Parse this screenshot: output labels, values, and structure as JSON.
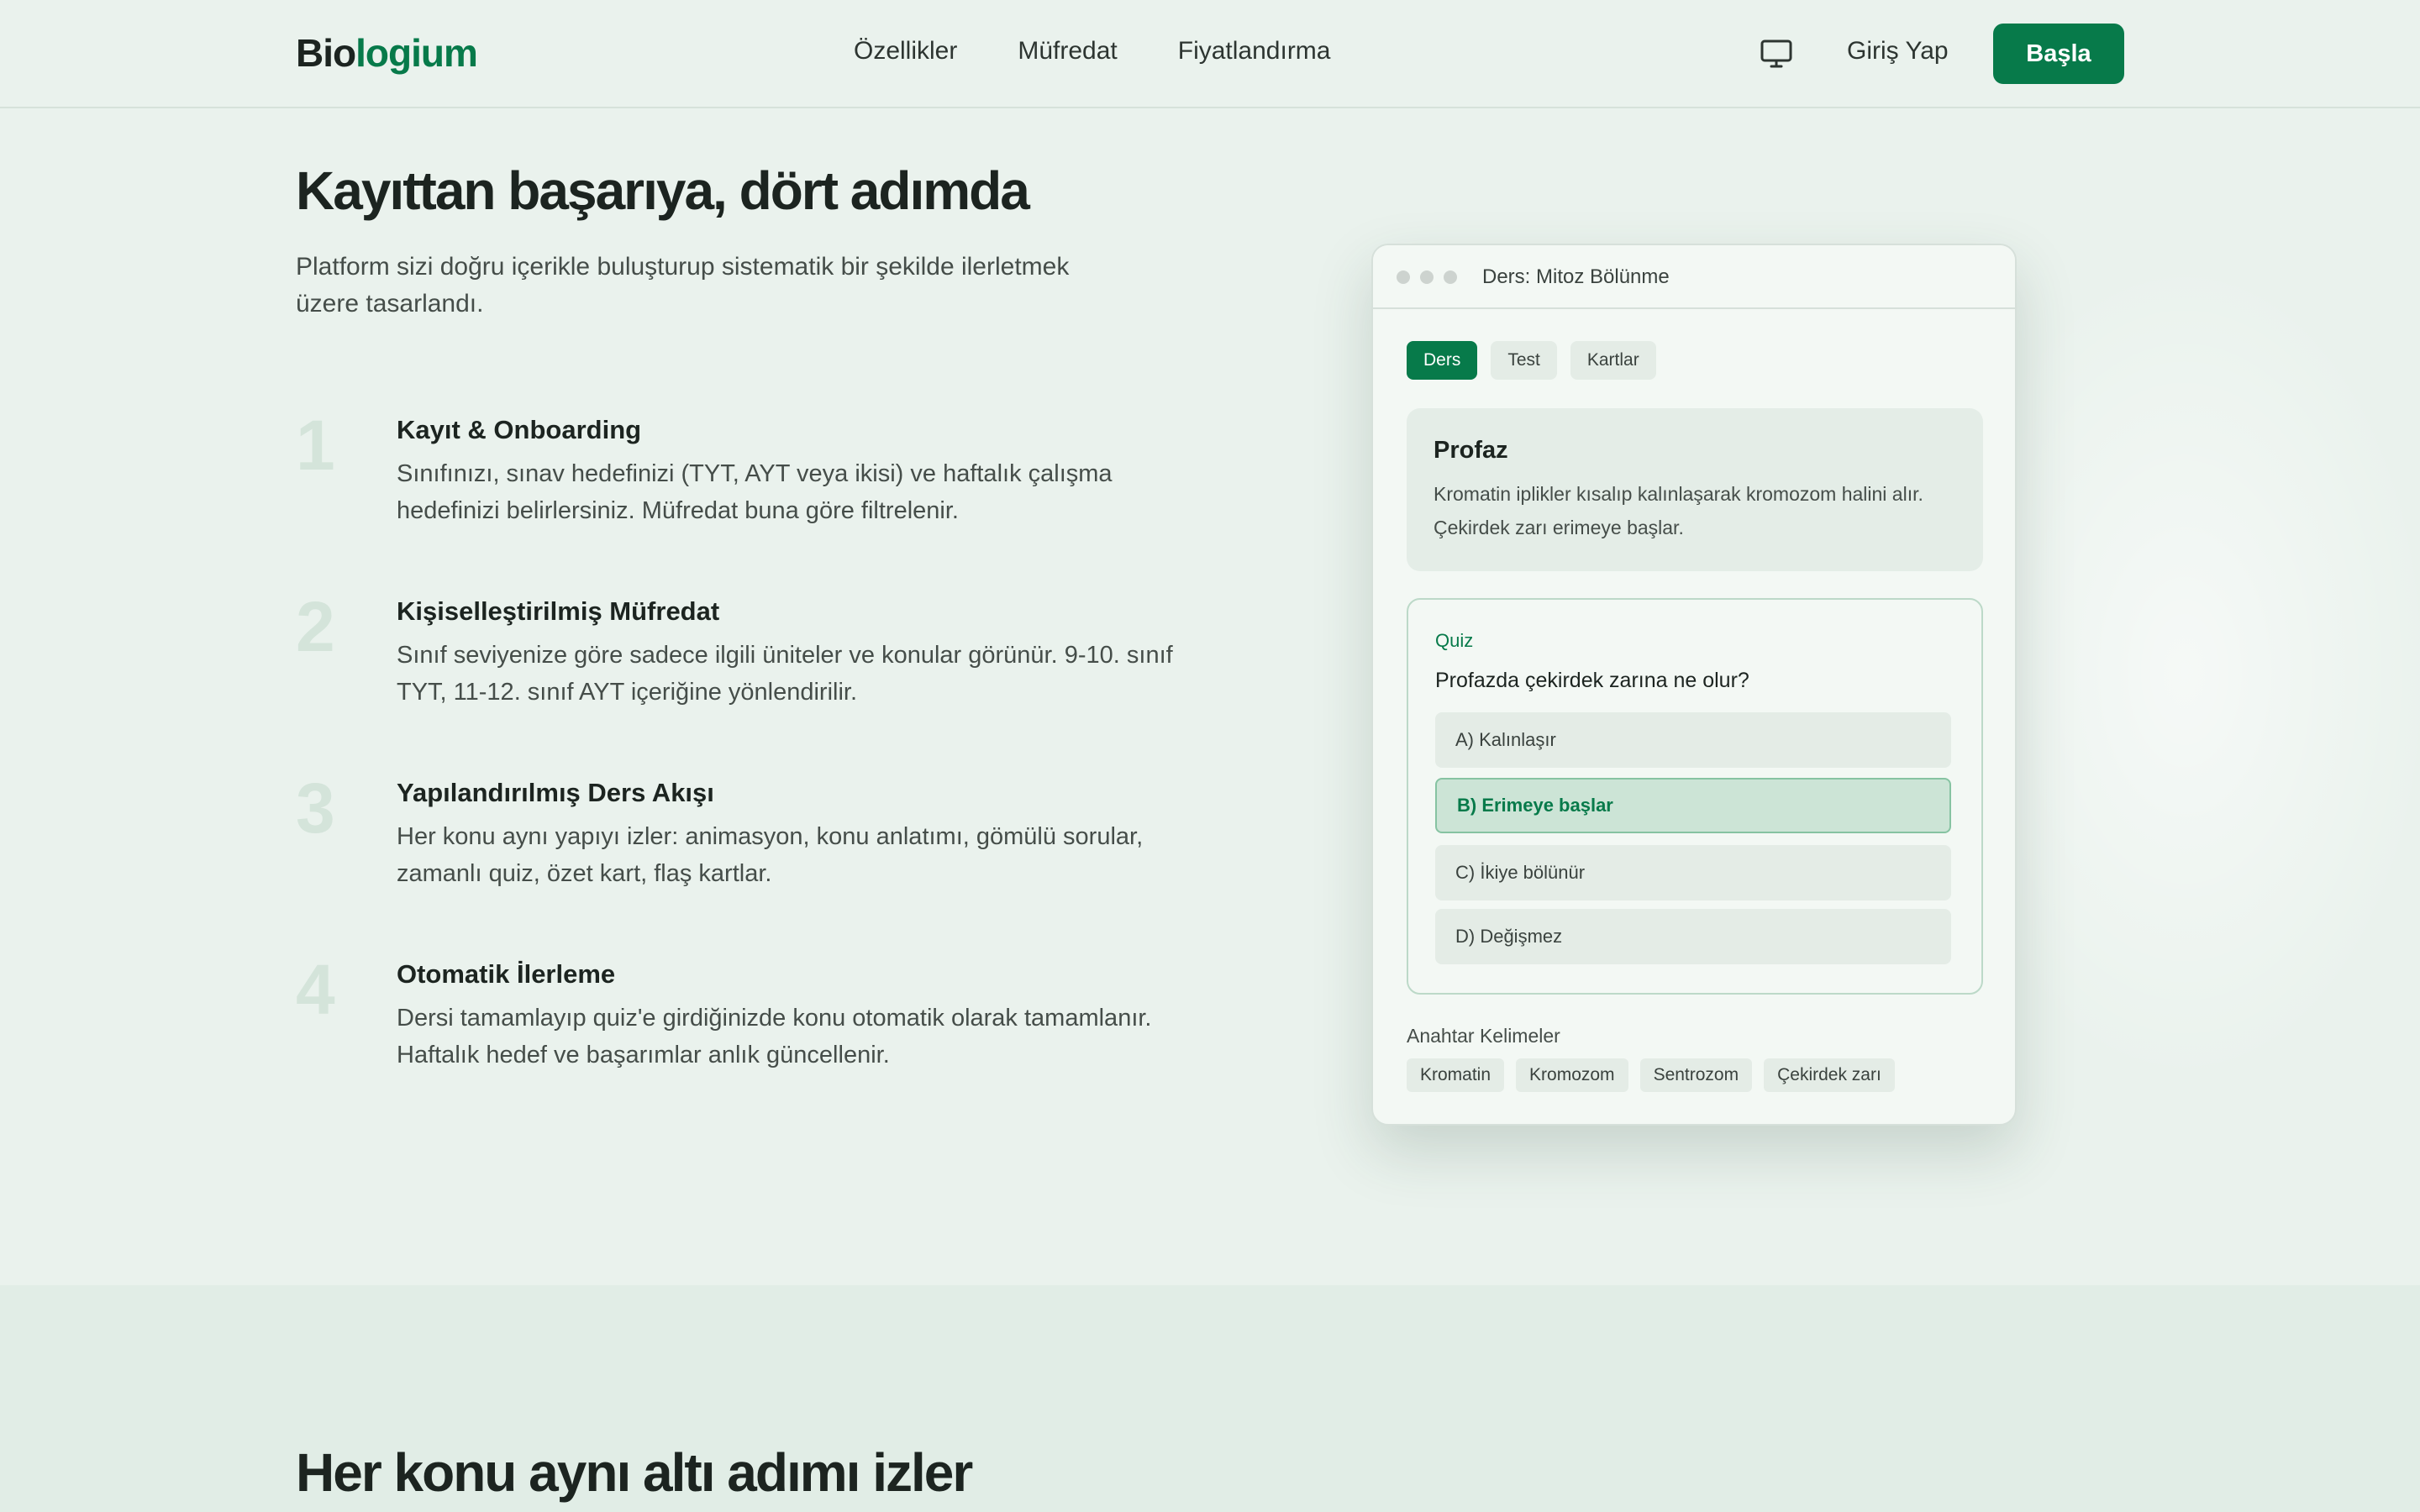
{
  "nav": {
    "logo_part1": "Bio",
    "logo_part2": "logium",
    "links": [
      "Özellikler",
      "Müfredat",
      "Fiyatlandırma"
    ],
    "login": "Giriş Yap",
    "cta": "Başla"
  },
  "hero": {
    "title": "Kayıttan başarıya, dört adımda",
    "subtitle": "Platform sizi doğru içerikle buluşturup sistematik bir şekilde ilerletmek üzere tasarlandı.",
    "steps": [
      {
        "num": "1",
        "title": "Kayıt & Onboarding",
        "desc": "Sınıfınızı, sınav hedefinizi (TYT, AYT veya ikisi) ve haftalık çalışma hedefinizi belirlersiniz. Müfredat buna göre filtrelenir."
      },
      {
        "num": "2",
        "title": "Kişiselleştirilmiş Müfredat",
        "desc": "Sınıf seviyenize göre sadece ilgili üniteler ve konular görünür. 9-10. sınıf TYT, 11-12. sınıf AYT içeriğine yönlendirilir."
      },
      {
        "num": "3",
        "title": "Yapılandırılmış Ders Akışı",
        "desc": "Her konu aynı yapıyı izler: animasyon, konu anlatımı, gömülü sorular, zamanlı quiz, özet kart, flaş kartlar."
      },
      {
        "num": "4",
        "title": "Otomatik İlerleme",
        "desc": "Dersi tamamlayıp quiz'e girdiğinizde konu otomatik olarak tamamlanır. Haftalık hedef ve başarımlar anlık güncellenir."
      }
    ]
  },
  "window": {
    "title": "Ders: Mitoz Bölünme",
    "tabs": [
      "Ders",
      "Test",
      "Kartlar"
    ],
    "active_tab": "Ders",
    "lesson": {
      "title": "Profaz",
      "text": "Kromatin iplikler kısalıp kalınlaşarak kromozom halini alır. Çekirdek zarı erimeye başlar."
    },
    "quiz": {
      "label": "Quiz",
      "question": "Profazda çekirdek zarına ne olur?",
      "options": [
        "A) Kalınlaşır",
        "B) Erimeye başlar",
        "C) İkiye bölünür",
        "D) Değişmez"
      ],
      "selected": "B) Erimeye başlar"
    },
    "keywords_label": "Anahtar Kelimeler",
    "keywords": [
      "Kromatin",
      "Kromozom",
      "Sentrozom",
      "Çekirdek zarı"
    ]
  },
  "section2": {
    "title": "Her konu aynı altı adımı izler"
  },
  "colors": {
    "brand": "#077a4a",
    "background": "#eaf2ed",
    "text": "#1c2420"
  },
  "icons": {
    "display": "monitor-icon"
  }
}
